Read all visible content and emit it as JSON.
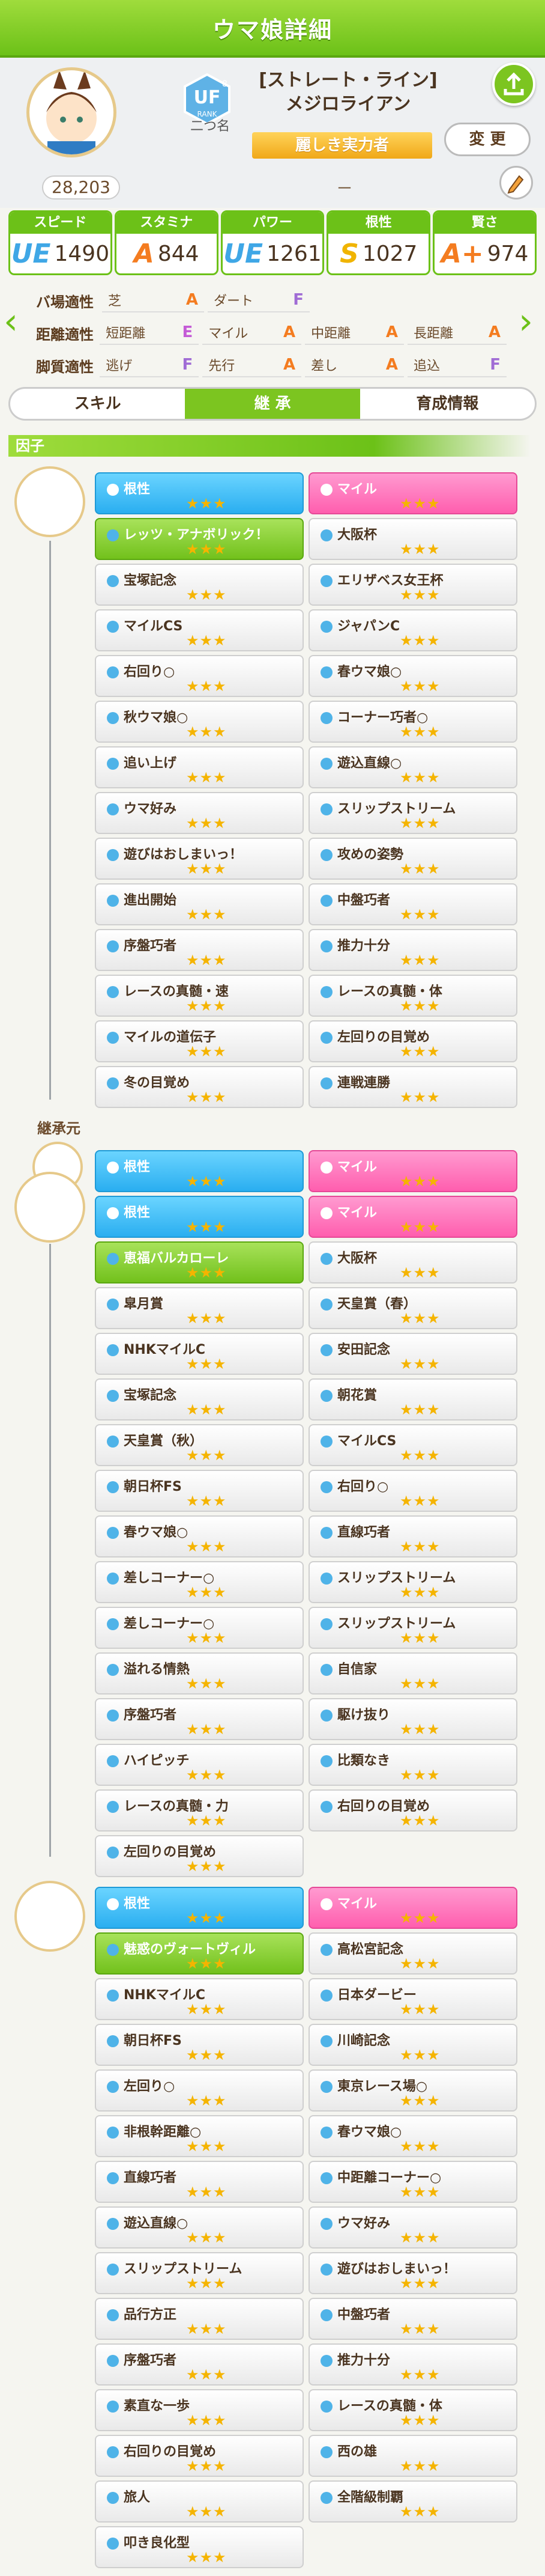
{
  "window": {
    "title": "ウマ娘詳細"
  },
  "profile": {
    "score": "28,203",
    "rank_name": "二つ名",
    "rank_label": "RANK",
    "rank_grade": "UF",
    "rank_sub": "8",
    "epithet": "[ストレート・ライン]",
    "name": "メジロライアン",
    "title_badge": "麗しき実力者",
    "dash": "－",
    "change_label": "変 更"
  },
  "stats": [
    {
      "label": "スピード",
      "grade": "UE",
      "value": "1490"
    },
    {
      "label": "スタミナ",
      "grade": "A",
      "value": "844"
    },
    {
      "label": "パワー",
      "grade": "UE",
      "value": "1261"
    },
    {
      "label": "根性",
      "grade": "S",
      "value": "1027"
    },
    {
      "label": "賢さ",
      "grade": "A+",
      "value": "974"
    }
  ],
  "aptitude": {
    "rows": [
      {
        "label": "バ場適性",
        "cells": [
          {
            "n": "芝",
            "g": "A"
          },
          {
            "n": "ダート",
            "g": "F"
          }
        ]
      },
      {
        "label": "距離適性",
        "cells": [
          {
            "n": "短距離",
            "g": "E"
          },
          {
            "n": "マイル",
            "g": "A"
          },
          {
            "n": "中距離",
            "g": "A"
          },
          {
            "n": "長距離",
            "g": "A"
          }
        ]
      },
      {
        "label": "脚質適性",
        "cells": [
          {
            "n": "逃げ",
            "g": "F"
          },
          {
            "n": "先行",
            "g": "A"
          },
          {
            "n": "差し",
            "g": "A"
          },
          {
            "n": "追込",
            "g": "F"
          }
        ]
      }
    ]
  },
  "tabs": [
    "スキル",
    "継 承",
    "育成情報"
  ],
  "sections": {
    "factors": "因子",
    "inherit": "継承元"
  },
  "factors_main": [
    [
      "根性",
      "マイル"
    ],
    [
      "レッツ・アナボリック！",
      "大阪杯"
    ],
    [
      "宝塚記念",
      "エリザベス女王杯"
    ],
    [
      "マイルCS",
      "ジャパンC"
    ],
    [
      "右回り○",
      "春ウマ娘○"
    ],
    [
      "秋ウマ娘○",
      "コーナー巧者○"
    ],
    [
      "追い上げ",
      "遊込直線○"
    ],
    [
      "ウマ好み",
      "スリップストリーム"
    ],
    [
      "遊びはおしまいっ！",
      "攻めの姿勢"
    ],
    [
      "進出開始",
      "中盤巧者"
    ],
    [
      "序盤巧者",
      "推力十分"
    ],
    [
      "レースの真髄・速",
      "レースの真髄・体"
    ],
    [
      "マイルの道伝子",
      "左回りの目覚め"
    ],
    [
      "冬の目覚め",
      "連戦連勝"
    ]
  ],
  "factors_p1": [
    [
      "根性",
      "マイル"
    ],
    [
      "根性",
      "マイル"
    ],
    [
      "恵福バルカローレ",
      "大阪杯"
    ],
    [
      "皐月賞",
      "天皇賞（春）"
    ],
    [
      "NHKマイルC",
      "安田記念"
    ],
    [
      "宝塚記念",
      "朝花賞"
    ],
    [
      "天皇賞（秋）",
      "マイルCS"
    ],
    [
      "朝日杯FS",
      "右回り○"
    ],
    [
      "春ウマ娘○",
      "直線巧者"
    ],
    [
      "差しコーナー○",
      "スリップストリーム"
    ],
    [
      "差しコーナー○",
      "スリップストリーム"
    ],
    [
      "溢れる情熱",
      "自信家"
    ],
    [
      "序盤巧者",
      "駆け抜り"
    ],
    [
      "ハイピッチ",
      "比類なき"
    ],
    [
      "レースの真髄・力",
      "右回りの目覚め"
    ],
    [
      "左回りの目覚め",
      ""
    ]
  ],
  "factors_p2": [
    [
      "根性",
      "マイル"
    ],
    [
      "魅惑のヴォートヴィル",
      "高松宮記念"
    ],
    [
      "NHKマイルC",
      "日本ダービー"
    ],
    [
      "朝日杯FS",
      "川崎記念"
    ],
    [
      "左回り○",
      "東京レース場○"
    ],
    [
      "非根幹距離○",
      "春ウマ娘○"
    ],
    [
      "直線巧者",
      "中距離コーナー○"
    ],
    [
      "遊込直線○",
      "ウマ好み"
    ],
    [
      "スリップストリーム",
      "遊びはおしまいっ！"
    ],
    [
      "品行方正",
      "中盤巧者"
    ],
    [
      "序盤巧者",
      "推力十分"
    ],
    [
      "素直な一歩",
      "レースの真髄・体"
    ],
    [
      "右回りの目覚め",
      "西の雄"
    ],
    [
      "旅人",
      "全階級制覇"
    ],
    [
      "叩き良化型",
      ""
    ]
  ]
}
